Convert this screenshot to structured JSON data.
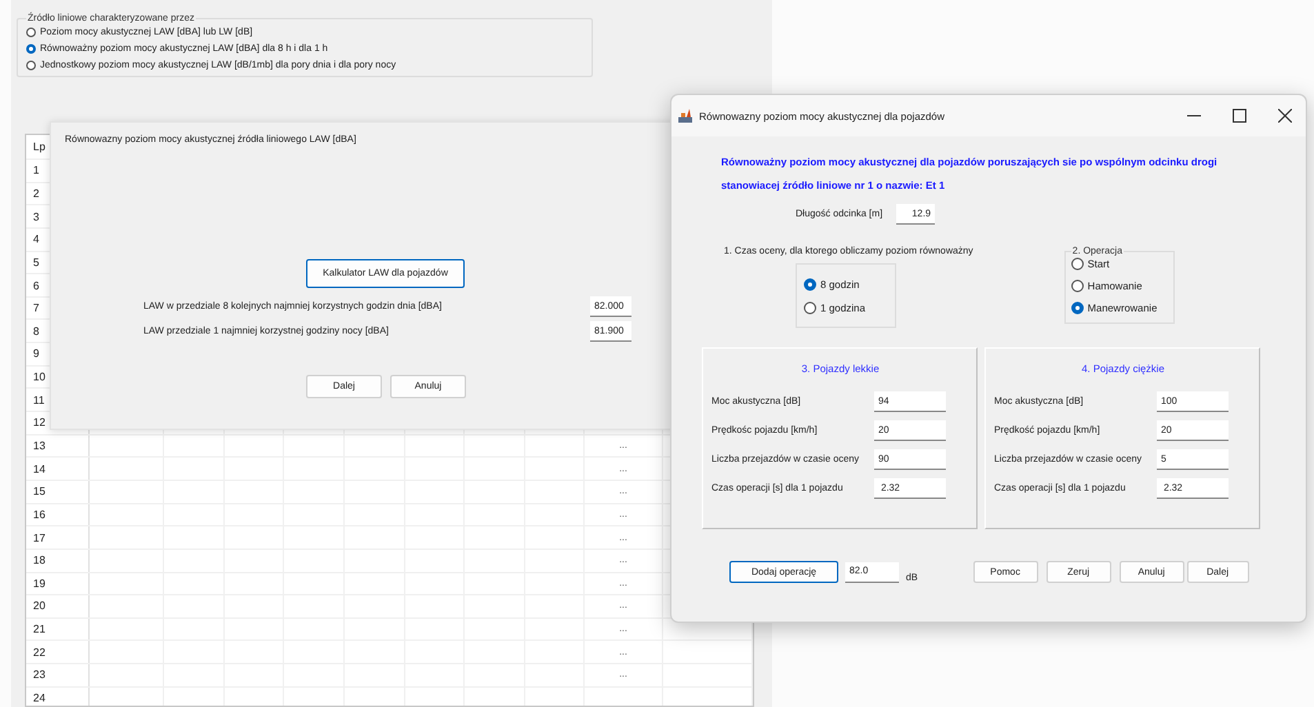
{
  "source_group": {
    "legend": "Źródło liniowe charakteryzowane przez",
    "options": [
      {
        "label": "Poziom mocy akustycznej  LAW [dBA]  lub LW [dB]",
        "selected": false
      },
      {
        "label": "Równoważny poziom mocy akustycznej LAW [dBA]  dla 8 h i  dla 1 h",
        "selected": true
      },
      {
        "label": "Jednostkowy poziom mocy akustycznej LAW  [dB/1mb]  dla pory dnia i dla pory nocy",
        "selected": false
      }
    ]
  },
  "grid": {
    "header": "Lp",
    "rows": [
      {
        "number": "1"
      },
      {
        "number": "2"
      },
      {
        "number": "3"
      },
      {
        "number": "4"
      },
      {
        "number": "5"
      },
      {
        "number": "6"
      },
      {
        "number": "7"
      },
      {
        "number": "8"
      },
      {
        "number": "9"
      },
      {
        "number": "10"
      },
      {
        "number": "11"
      },
      {
        "number": "12"
      },
      {
        "number": "13",
        "column_10": "..."
      },
      {
        "number": "14",
        "column_10": "..."
      },
      {
        "number": "15",
        "column_10": "..."
      },
      {
        "number": "16",
        "column_10": "..."
      },
      {
        "number": "17",
        "column_10": "..."
      },
      {
        "number": "18",
        "column_10": "..."
      },
      {
        "number": "19",
        "column_10": "..."
      },
      {
        "number": "20",
        "column_10": "..."
      },
      {
        "number": "21",
        "column_10": "..."
      },
      {
        "number": "22",
        "column_10": "..."
      },
      {
        "number": "23",
        "column_10": "..."
      },
      {
        "number": "24"
      }
    ]
  },
  "law_dialog": {
    "title": "Równowazny poziom mocy akustycznej źródła liniowego LAW [dBA]",
    "calculator_button": "Kalkulator LAW  dla pojazdów",
    "fields": [
      {
        "label": "LAW w przedziale  8 kolejnych najmniej korzystnych  godzin dnia [dBA]",
        "value": "82.000"
      },
      {
        "label": "LAW przedziale  1 najmniej korzystnej godziny nocy [dBA]",
        "value": "81.900"
      }
    ],
    "buttons": [
      "Dalej",
      "Anuluj"
    ]
  },
  "vehicle_dialog": {
    "title": "Równowazny poziom mocy akustycznej dla pojazdów",
    "heading": "Równoważny poziom mocy akustycznej dla pojazdów poruszających sie po wspólnym odcinku drogi stanowiacej  źródło  liniowe   nr 1 o nazwie: Et  1",
    "length": {
      "label": "Długość odcinka  [m]",
      "value": "12.9"
    },
    "time_group": {
      "label": "1. Czas oceny, dla ktorego obliczamy poziom równoważny",
      "options": [
        {
          "label": "8 godzin",
          "selected": true
        },
        {
          "label": "1 godzina",
          "selected": false
        }
      ]
    },
    "operation_group": {
      "legend": "2. Operacja",
      "options": [
        {
          "label": "Start",
          "selected": false
        },
        {
          "label": "Hamowanie",
          "selected": false
        },
        {
          "label": "Manewrowanie",
          "selected": true
        }
      ]
    },
    "panels": [
      {
        "title": "3. Pojazdy lekkie",
        "fields": [
          {
            "label": "Moc akustyczna [dB]",
            "value": "94"
          },
          {
            "label": "Prędkośc pojazdu [km/h]",
            "value": "20"
          },
          {
            "label": "Liczba przejazdów w czasie oceny",
            "value": "90"
          },
          {
            "label": "Czas operacji   [s] dla 1 pojazdu",
            "value": " 2.32"
          }
        ]
      },
      {
        "title": "4. Pojazdy ciężkie",
        "fields": [
          {
            "label": "Moc akustyczna [dB]",
            "value": "100"
          },
          {
            "label": "Prędkość pojazdu [km/h]",
            "value": "20"
          },
          {
            "label": "Liczba przejazdów w  czasie oceny",
            "value": "5"
          },
          {
            "label": "Czas operacji  [s] dla 1 pojazdu",
            "value": " 2.32"
          }
        ]
      }
    ],
    "add_button": "Dodaj operację",
    "result": {
      "value": "82.0",
      "unit": "dB"
    },
    "buttons": [
      "Pomoc",
      "Zeruj",
      "Anuluj",
      "Dalej"
    ]
  }
}
